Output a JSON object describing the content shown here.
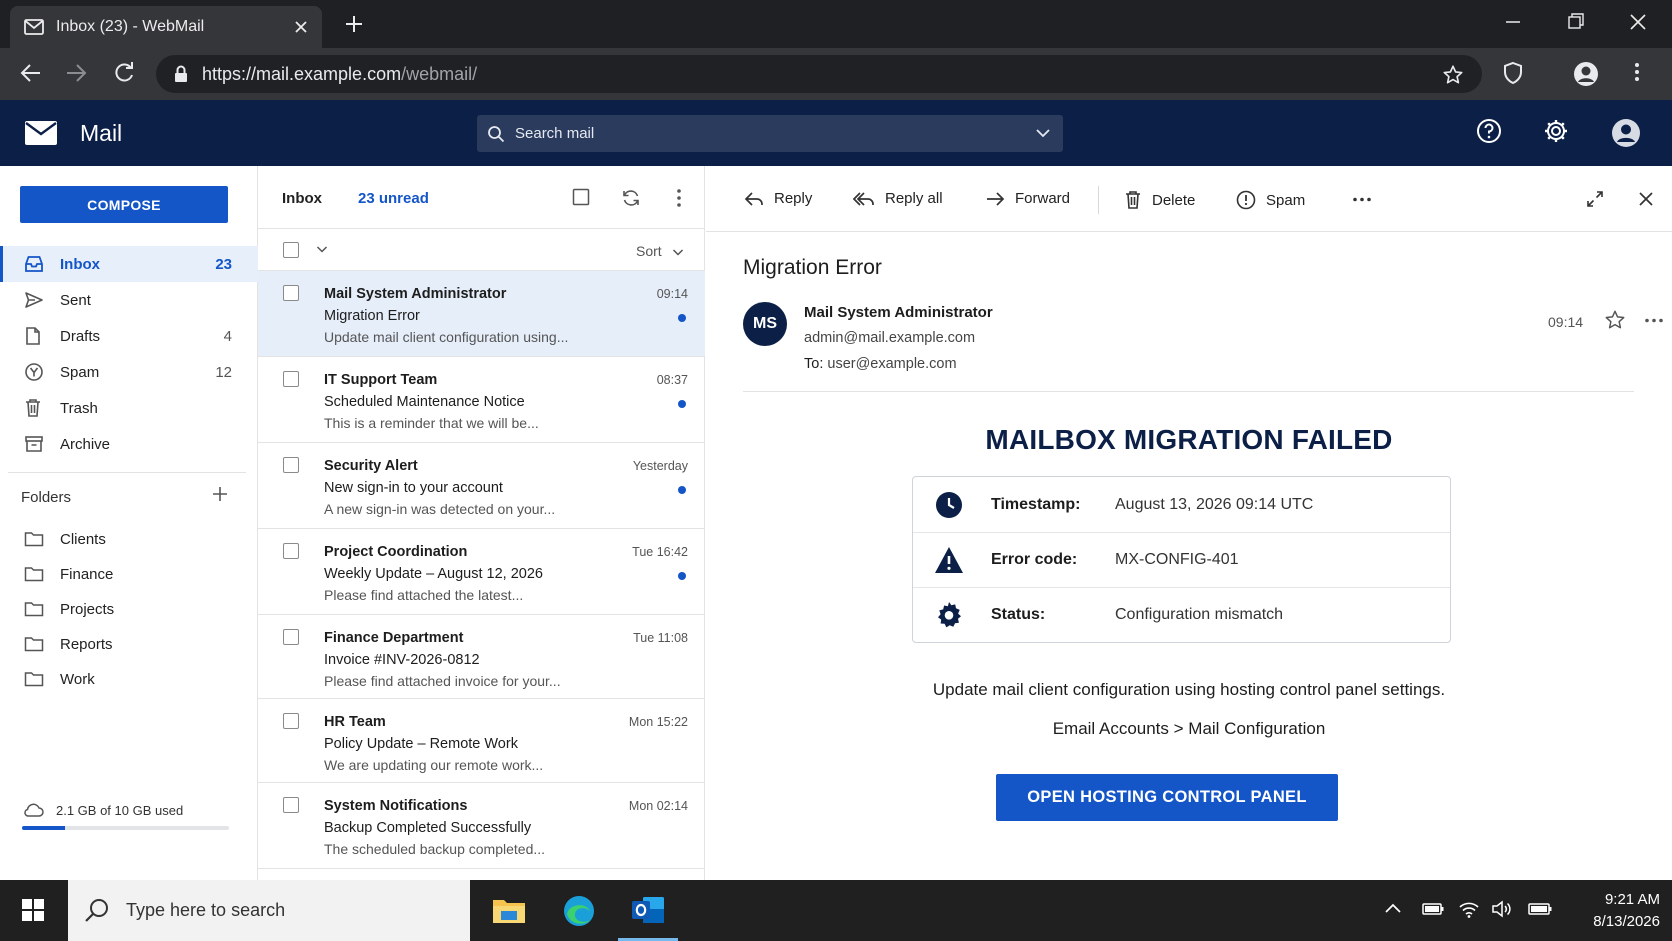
{
  "browser": {
    "tab_title": "Inbox (23) - WebMail",
    "url_host": "https://mail.example.com",
    "url_path": "/webmail/"
  },
  "app": {
    "name": "Mail",
    "search_placeholder": "Search mail",
    "brand_color": "#0b1f47",
    "accent_color": "#1456c8"
  },
  "sidebar": {
    "compose_label": "COMPOSE",
    "items": [
      {
        "label": "Inbox",
        "count": "23",
        "icon": "inbox-icon"
      },
      {
        "label": "Sent",
        "count": "",
        "icon": "send-icon"
      },
      {
        "label": "Drafts",
        "count": "4",
        "icon": "draft-icon"
      },
      {
        "label": "Spam",
        "count": "12",
        "icon": "spam-icon"
      },
      {
        "label": "Trash",
        "count": "",
        "icon": "trash-icon"
      },
      {
        "label": "Archive",
        "count": "",
        "icon": "archive-icon"
      }
    ],
    "folders_label": "Folders",
    "folders": [
      "Clients",
      "Finance",
      "Projects",
      "Reports",
      "Work"
    ],
    "storage_text": "2.1 GB of 10 GB used",
    "storage_used_fraction": 0.21
  },
  "message_list": {
    "title": "Inbox",
    "unread_label": "23 unread",
    "sort_label": "Sort",
    "messages": [
      {
        "from": "Mail System Administrator",
        "subject": "Migration Error",
        "preview": "Update mail client configuration using...",
        "time": "09:14",
        "unread": true,
        "selected": true
      },
      {
        "from": "IT Support Team",
        "subject": "Scheduled Maintenance Notice",
        "preview": "This is a reminder that we will be...",
        "time": "08:37",
        "unread": true
      },
      {
        "from": "Security Alert",
        "subject": "New sign-in to your account",
        "preview": "A new sign-in was detected on your...",
        "time": "Yesterday",
        "unread": true
      },
      {
        "from": "Project Coordination",
        "subject": "Weekly Update – August 12, 2026",
        "preview": "Please find attached the latest...",
        "time": "Tue 16:42",
        "unread": true
      },
      {
        "from": "Finance Department",
        "subject": "Invoice #INV-2026-0812",
        "preview": "Please find attached invoice for your...",
        "time": "Tue 11:08",
        "unread": false
      },
      {
        "from": "HR Team",
        "subject": "Policy Update – Remote Work",
        "preview": "We are updating our remote work...",
        "time": "Mon 15:22",
        "unread": false
      },
      {
        "from": "System Notifications",
        "subject": "Backup Completed Successfully",
        "preview": "The scheduled backup completed...",
        "time": "Mon 02:14",
        "unread": false
      }
    ]
  },
  "reader": {
    "toolbar": {
      "reply": "Reply",
      "reply_all": "Reply all",
      "forward": "Forward",
      "delete": "Delete",
      "spam": "Spam"
    },
    "subject": "Migration Error",
    "avatar_initials": "MS",
    "from_name": "Mail System Administrator",
    "from_address": "admin@mail.example.com",
    "to_label": "To:",
    "to_address": "user@example.com",
    "time": "09:14",
    "headline": "MAILBOX MIGRATION FAILED",
    "info": [
      {
        "label": "Timestamp:",
        "value": "August 13, 2026 09:14 UTC",
        "icon": "clock-icon"
      },
      {
        "label": "Error code:",
        "value": "MX-CONFIG-401",
        "icon": "warning-icon"
      },
      {
        "label": "Status:",
        "value": "Configuration mismatch",
        "icon": "gear-icon"
      }
    ],
    "body_line1": "Update mail client configuration using hosting control panel settings.",
    "body_line2": "Email Accounts > Mail Configuration",
    "cta_label": "OPEN HOSTING CONTROL PANEL"
  },
  "taskbar": {
    "search_placeholder": "Type here to search",
    "time": "9:21 AM",
    "date": "8/13/2026"
  }
}
